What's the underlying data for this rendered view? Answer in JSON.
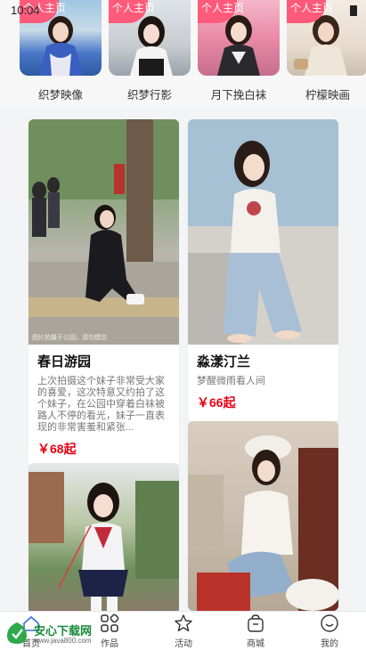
{
  "status": {
    "time": "10:04"
  },
  "creators": [
    {
      "badge": "个人主页",
      "name": "织梦映像"
    },
    {
      "badge": "个人主页",
      "name": "织梦行影"
    },
    {
      "badge": "个人主页",
      "name": "月下挽白袜"
    },
    {
      "badge": "个人主页",
      "name": "柠檬映画"
    }
  ],
  "cards": [
    {
      "title": "春日游园",
      "desc": "上次拍摄这个妹子非常受大家的喜爱，这次特意又约拍了这个妹子，在公园中穿着白袜被路人不停的看光，妹子一直表现的非常害羞和紧张...",
      "price": "￥68起",
      "image_caption": "图片拍摄于公园，请勿模仿"
    },
    {
      "title": "淼漾汀兰",
      "desc": "梦醒微雨看人间",
      "price": "￥66起"
    },
    {
      "title": "",
      "desc": "",
      "price": ""
    },
    {
      "title": "",
      "desc": "",
      "price": ""
    }
  ],
  "tabbar": {
    "items": [
      {
        "label": "首页",
        "icon": "home-icon"
      },
      {
        "label": "作品",
        "icon": "grid-icon"
      },
      {
        "label": "活动",
        "icon": "star-icon"
      },
      {
        "label": "商城",
        "icon": "shopping-bag-icon"
      },
      {
        "label": "我的",
        "icon": "smile-icon"
      }
    ]
  },
  "watermark": {
    "brand": "安心下载网",
    "url": "www.java800.com"
  },
  "colors": {
    "price": "#e60012",
    "badge": "#ff5a7a",
    "brand_green": "#1a8a3a"
  }
}
